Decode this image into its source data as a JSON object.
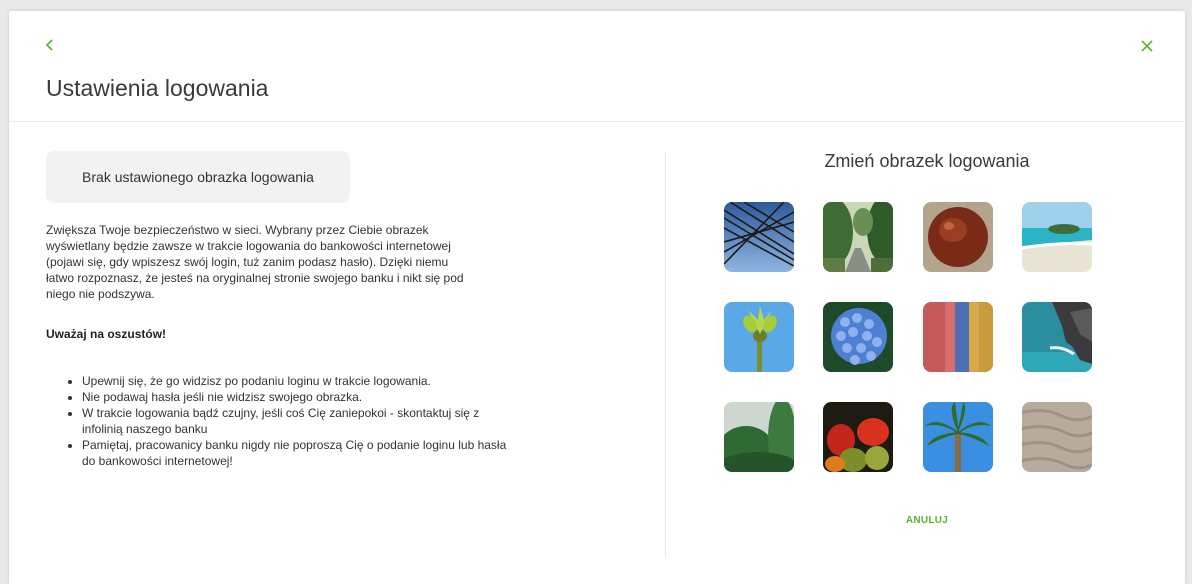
{
  "header": {
    "title": "Ustawienia logowania",
    "back_icon": "chevron-left-icon",
    "close_icon": "close-icon"
  },
  "left": {
    "status_text": "Brak ustawionego obrazka logowania",
    "description": "Zwiększa Twoje bezpieczeństwo w sieci. Wybrany przez Ciebie obrazek wyświetlany będzie zawsze w trakcie logowania do bankowości internetowej (pojawi się, gdy wpiszesz swój login, tuż zanim podasz hasło). Dzięki niemu łatwo rozpoznasz, że jesteś na oryginalnej stronie swojego banku i nikt się pod niego nie podszywa.",
    "warning_heading": "Uważaj na oszustów!",
    "tips": [
      "Upewnij się, że go widzisz po podaniu loginu w trakcie logowania.",
      "Nie podawaj hasła jeśli nie widzisz swojego obrazka.",
      "W trakcie logowania bądź czujny, jeśli coś Cię zaniepokoi - skontaktuj się z infolinią naszego banku",
      "Pamiętaj, pracowanicy banku nigdy nie poproszą Cię o podanie loginu lub hasła do bankowości internetowej!"
    ]
  },
  "right": {
    "title": "Zmień obrazek logowania",
    "cancel_label": "ANULUJ",
    "images": [
      "power-lines-image",
      "forest-road-image",
      "coconut-image",
      "beach-image",
      "plant-sprout-image",
      "hydrangea-image",
      "painted-wall-image",
      "sea-rocks-image",
      "misty-forest-image",
      "vegetables-image",
      "palm-tree-image",
      "sand-ripples-image"
    ]
  },
  "colors": {
    "accent": "#5fb132",
    "status_box_bg": "#f2f2f2",
    "text": "#333333"
  }
}
